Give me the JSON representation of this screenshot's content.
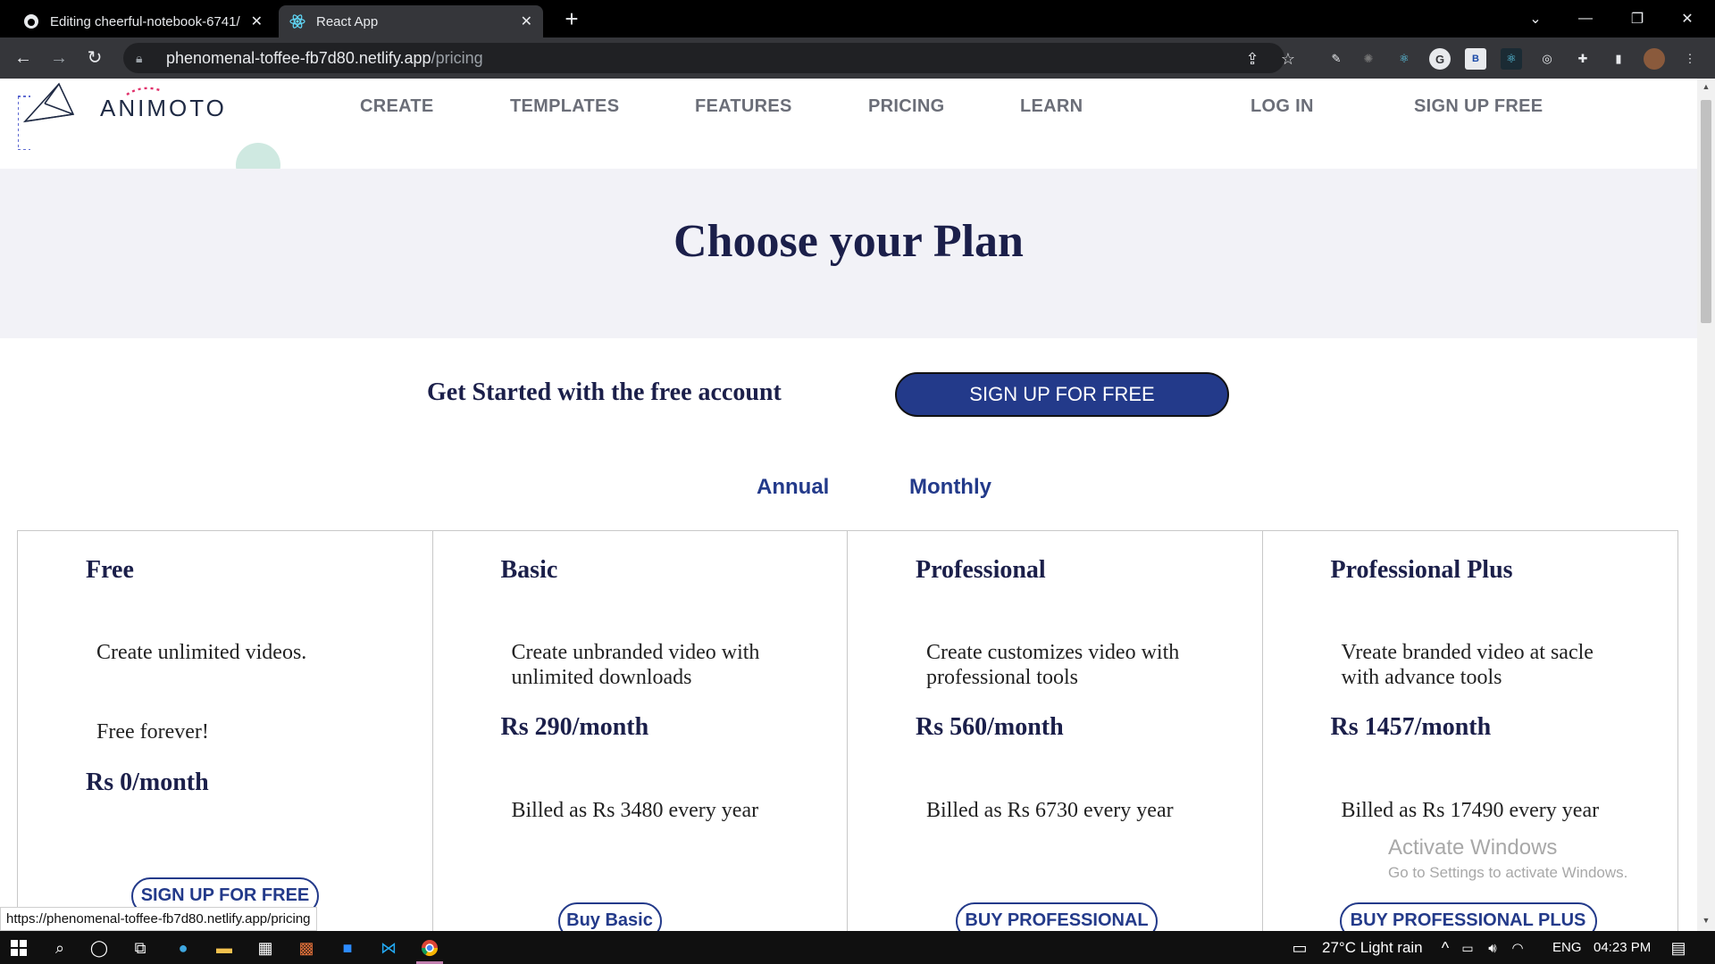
{
  "browser": {
    "tabs": [
      {
        "title": "Editing cheerful-notebook-6741/",
        "icon": "github-icon"
      },
      {
        "title": "React App",
        "icon": "react-icon"
      }
    ],
    "new_tab": "+",
    "url_host": "phenomenal-toffee-fb7d80.netlify.app",
    "url_path": "/pricing",
    "extensions": [
      "pen-icon",
      "bug-icon",
      "react-devtools-icon",
      "grammarly-icon",
      "b-icon",
      "react-icon",
      "target-icon",
      "puzzle-icon",
      "sidepanel-icon",
      "profile-avatar"
    ]
  },
  "site": {
    "logo": "ANIMOTO",
    "nav": [
      "CREATE",
      "TEMPLATES",
      "FEATURES",
      "PRICING",
      "LEARN"
    ],
    "login": "LOG IN",
    "signup": "SIGN UP FREE"
  },
  "hero": {
    "title": "Choose your Plan"
  },
  "cta": {
    "text": "Get Started with the free account",
    "button": "SIGN UP FOR FREE"
  },
  "billing_toggle": {
    "annual": "Annual",
    "monthly": "Monthly"
  },
  "plans": [
    {
      "name": "Free",
      "desc": "Create unlimited videos.",
      "note": "Free forever!",
      "price": "Rs 0/month",
      "billed": "",
      "button": "SIGN UP FOR FREE"
    },
    {
      "name": "Basic",
      "desc": "Create unbranded video with unlimited downloads",
      "note": "",
      "price": "Rs 290/month",
      "billed": "Billed as Rs 3480 every year",
      "button": "Buy Basic"
    },
    {
      "name": "Professional",
      "desc": "Create customizes video with professional tools",
      "note": "",
      "price": "Rs 560/month",
      "billed": "Billed as Rs 6730 every year",
      "button": "BUY PROFESSIONAL"
    },
    {
      "name": "Professional Plus",
      "desc": "Vreate branded video at sacle with advance tools",
      "note": "",
      "price": "Rs 1457/month",
      "billed": "Billed as Rs 17490 every year",
      "button": "BUY PROFESSIONAL PLUS"
    }
  ],
  "watermark": {
    "line1": "Activate Windows",
    "line2": "Go to Settings to activate Windows."
  },
  "status_url": "https://phenomenal-toffee-fb7d80.netlify.app/pricing",
  "taskbar": {
    "weather": "27°C  Light rain",
    "lang": "ENG",
    "time": "04:23 PM"
  },
  "colors": {
    "brand_navy": "#1b1f4a",
    "button_blue": "#233a8a",
    "hero_bg": "#f2f2f7"
  }
}
